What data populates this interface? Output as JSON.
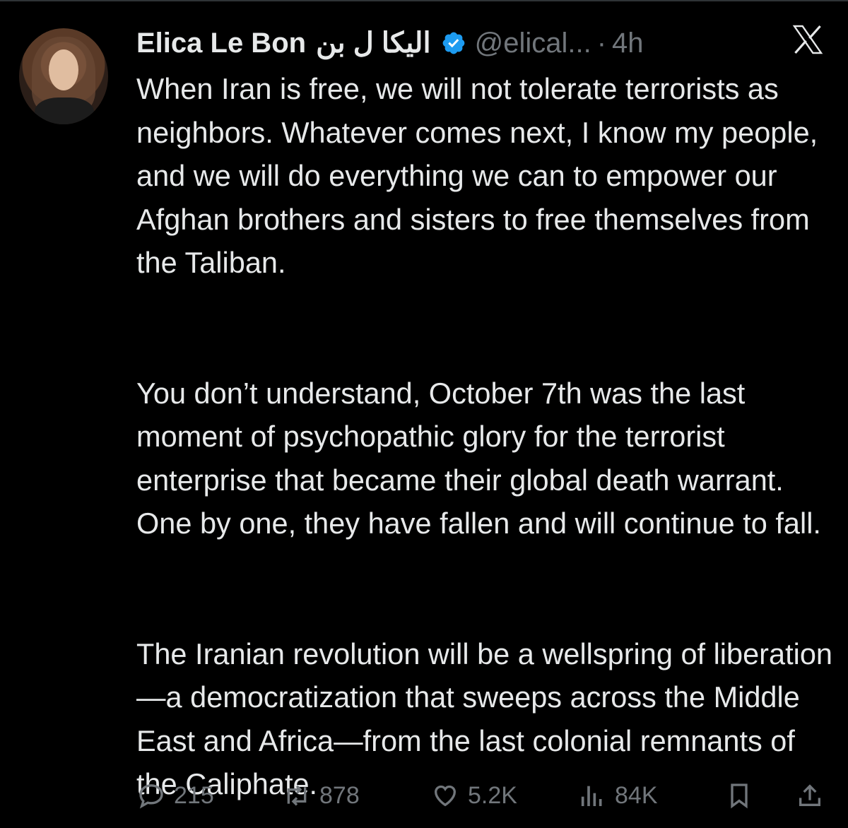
{
  "author": {
    "name": "Elica Le Bon",
    "name_arabic": "اليكا ل بن",
    "handle": "@elical...",
    "separator": "·",
    "time": "4h"
  },
  "tweet": {
    "paragraphs": [
      "When Iran is free, we will not tolerate terrorists as neighbors. Whatever comes next, I know my people, and we will do everything we can to empower our Afghan brothers and sisters to free themselves from the Taliban.",
      "You don’t understand, October 7th was the last moment of psychopathic glory for the terrorist enterprise that became their global death warrant. One by one, they have fallen and will continue to fall.",
      "The Iranian revolution will be a wellspring of liberation—a democratization that sweeps across the Middle East and Africa—from the last colonial remnants of the Caliphate."
    ]
  },
  "metrics": {
    "replies": "215",
    "reposts": "878",
    "likes": "5.2K",
    "views": "84K"
  },
  "colors": {
    "background": "#000000",
    "text": "#e7e9ea",
    "muted": "#71767b",
    "verified": "#1d9bf0"
  },
  "icons": [
    "verified-badge-icon",
    "x-logo-icon",
    "reply-icon",
    "repost-icon",
    "like-icon",
    "views-icon",
    "bookmark-icon",
    "share-icon"
  ]
}
